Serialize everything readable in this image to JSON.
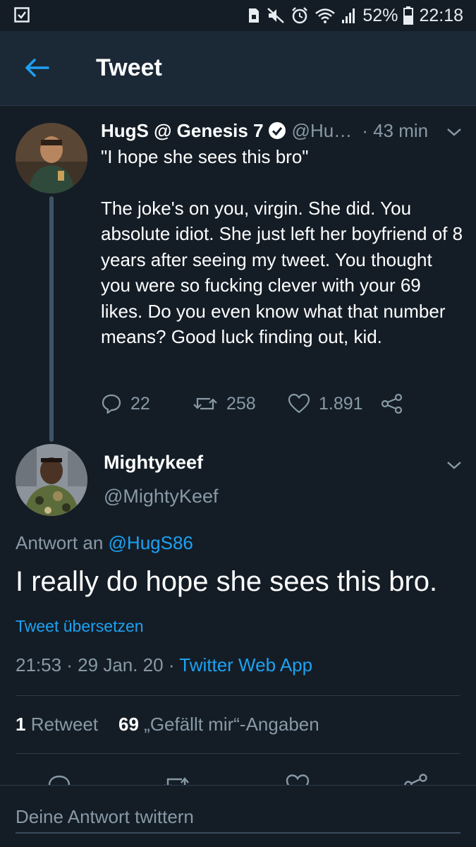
{
  "status_bar": {
    "battery": "52%",
    "time": "22:18"
  },
  "header": {
    "title": "Tweet"
  },
  "parent_tweet": {
    "name": "HugS @ Genesis 7",
    "handle": "@Hu…",
    "time": "· 43 min",
    "quote": "\"I hope she sees this bro\"",
    "body": "The joke's on you, virgin. She did. You absolute idiot. She just left her boyfriend of 8 years after seeing my tweet. You thought you were so fucking clever with your 69 likes. Do you even know what that number means? Good luck finding out, kid.",
    "replies": "22",
    "retweets": "258",
    "likes": "1.891"
  },
  "focus_tweet": {
    "name": "Mightykeef",
    "handle": "@MightyKeef",
    "reply_prefix": "Antwort an",
    "reply_mention": "@HugS86",
    "text": "I really do hope she sees this bro.",
    "translate": "Tweet übersetzen",
    "timestamp": "21:53 · 29 Jan. 20 ·",
    "client": "Twitter Web App",
    "retweet_count": "1",
    "retweet_label": "Retweet",
    "like_count": "69",
    "like_label": "„Gefällt mir“-Angaben"
  },
  "compose": {
    "placeholder": "Deine Antwort twittern"
  },
  "colors": {
    "background": "#141d26",
    "header": "#1b2836",
    "accent": "#1da1f2",
    "muted": "#8899a6"
  }
}
